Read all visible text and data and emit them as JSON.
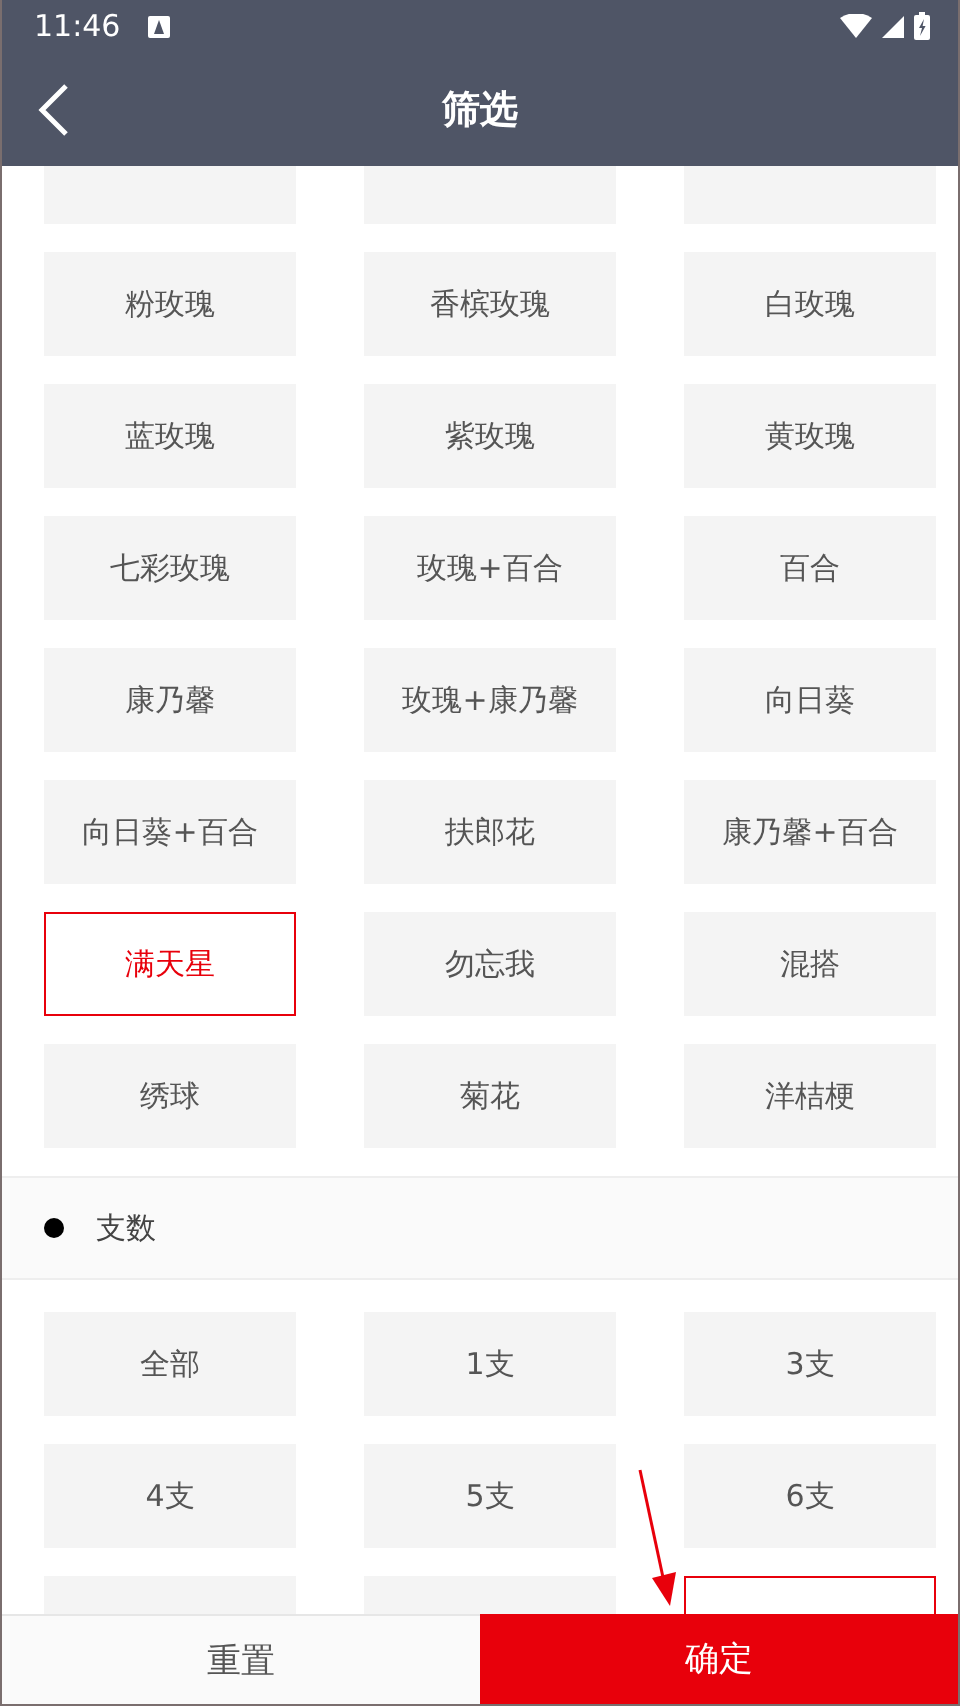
{
  "status_bar": {
    "time": "11:46"
  },
  "title_bar": {
    "title": "筛选"
  },
  "flower_options": [
    {
      "selected": false
    },
    {
      "selected": false
    },
    {
      "selected": false
    },
    {
      "label": "粉玫瑰",
      "selected": false
    },
    {
      "label": "香槟玫瑰",
      "selected": false
    },
    {
      "label": "白玫瑰",
      "selected": false
    },
    {
      "label": "蓝玫瑰",
      "selected": false
    },
    {
      "label": "紫玫瑰",
      "selected": false
    },
    {
      "label": "黄玫瑰",
      "selected": false
    },
    {
      "label": "七彩玫瑰",
      "selected": false
    },
    {
      "label": "玫瑰+百合",
      "selected": false
    },
    {
      "label": "百合",
      "selected": false
    },
    {
      "label": "康乃馨",
      "selected": false
    },
    {
      "label": "玫瑰+康乃馨",
      "selected": false
    },
    {
      "label": "向日葵",
      "selected": false
    },
    {
      "label": "向日葵+百合",
      "selected": false
    },
    {
      "label": "扶郎花",
      "selected": false
    },
    {
      "label": "康乃馨+百合",
      "selected": false
    },
    {
      "label": "满天星",
      "selected": true
    },
    {
      "label": "勿忘我",
      "selected": false
    },
    {
      "label": "混搭",
      "selected": false
    },
    {
      "label": "绣球",
      "selected": false
    },
    {
      "label": "菊花",
      "selected": false
    },
    {
      "label": "洋桔梗",
      "selected": false
    }
  ],
  "section": {
    "title": "支数"
  },
  "count_options": [
    {
      "label": "全部",
      "selected": false
    },
    {
      "label": "1支",
      "selected": false
    },
    {
      "label": "3支",
      "selected": false
    },
    {
      "label": "4支",
      "selected": false
    },
    {
      "label": "5支",
      "selected": false
    },
    {
      "label": "6支",
      "selected": false
    },
    {
      "selected": false
    },
    {
      "selected": false
    },
    {
      "selected": true
    }
  ],
  "buttons": [
    {
      "label": "重置",
      "kind": "secondary"
    },
    {
      "label": "确定",
      "kind": "primary"
    }
  ]
}
